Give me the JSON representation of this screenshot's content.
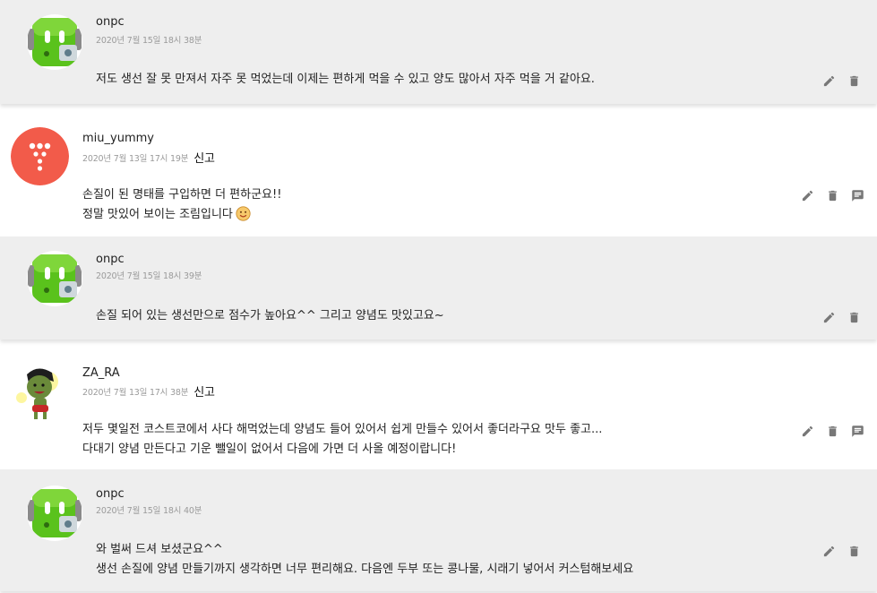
{
  "report_label": "신고",
  "comments": [
    {
      "author": "onpc",
      "date": "2020년 7월 15일 18시 38분",
      "lines": [
        "저도 생선 잘 못 만져서 자주 못 먹었는데 이제는 편하게 먹을 수 있고 양도 많아서 자주 먹을 거 같아요."
      ],
      "avatar_icon": "green-robot-avatar",
      "actions": [
        "edit-icon",
        "delete-icon"
      ]
    },
    {
      "author": "miu_yummy",
      "date": "2020년 7월 13일 17시 19분",
      "lines": [
        "손질이 된 명태를 구입하면 더 편하군요!!",
        "정말 맛있어 보이는 조림입니다"
      ],
      "avatar_icon": "red-dots-avatar",
      "actions": [
        "edit-icon",
        "delete-icon",
        "reply-icon"
      ]
    },
    {
      "author": "onpc",
      "date": "2020년 7월 15일 18시 39분",
      "lines": [
        "손질 되어 있는 생선만으로 점수가 높아요^^ 그리고 양념도 맛있고요~"
      ],
      "avatar_icon": "green-robot-avatar",
      "actions": [
        "edit-icon",
        "delete-icon"
      ]
    },
    {
      "author": "ZA_RA",
      "date": "2020년 7월 13일 17시 38분",
      "lines": [
        "저두 몇일전 코스트코에서 사다 해먹었는데 양념도 들어 있어서 쉽게 만들수 있어서 좋더라구요 맛두 좋고...",
        "다대기 양념 만든다고 기운 뺄일이 없어서 다음에 가면 더 사올 예정이랍니다!"
      ],
      "avatar_icon": "cartoon-character-avatar",
      "actions": [
        "edit-icon",
        "delete-icon",
        "reply-icon"
      ]
    },
    {
      "author": "onpc",
      "date": "2020년 7월 15일 18시 40분",
      "lines": [
        "와 벌써 드셔 보셨군요^^",
        "생선 손질에 양념 만들기까지 생각하면 너무 편리해요. 다음엔 두부 또는 콩나물, 시래기 넣어서 커스텀해보세요"
      ],
      "avatar_icon": "green-robot-avatar",
      "actions": [
        "edit-icon",
        "delete-icon"
      ]
    }
  ]
}
